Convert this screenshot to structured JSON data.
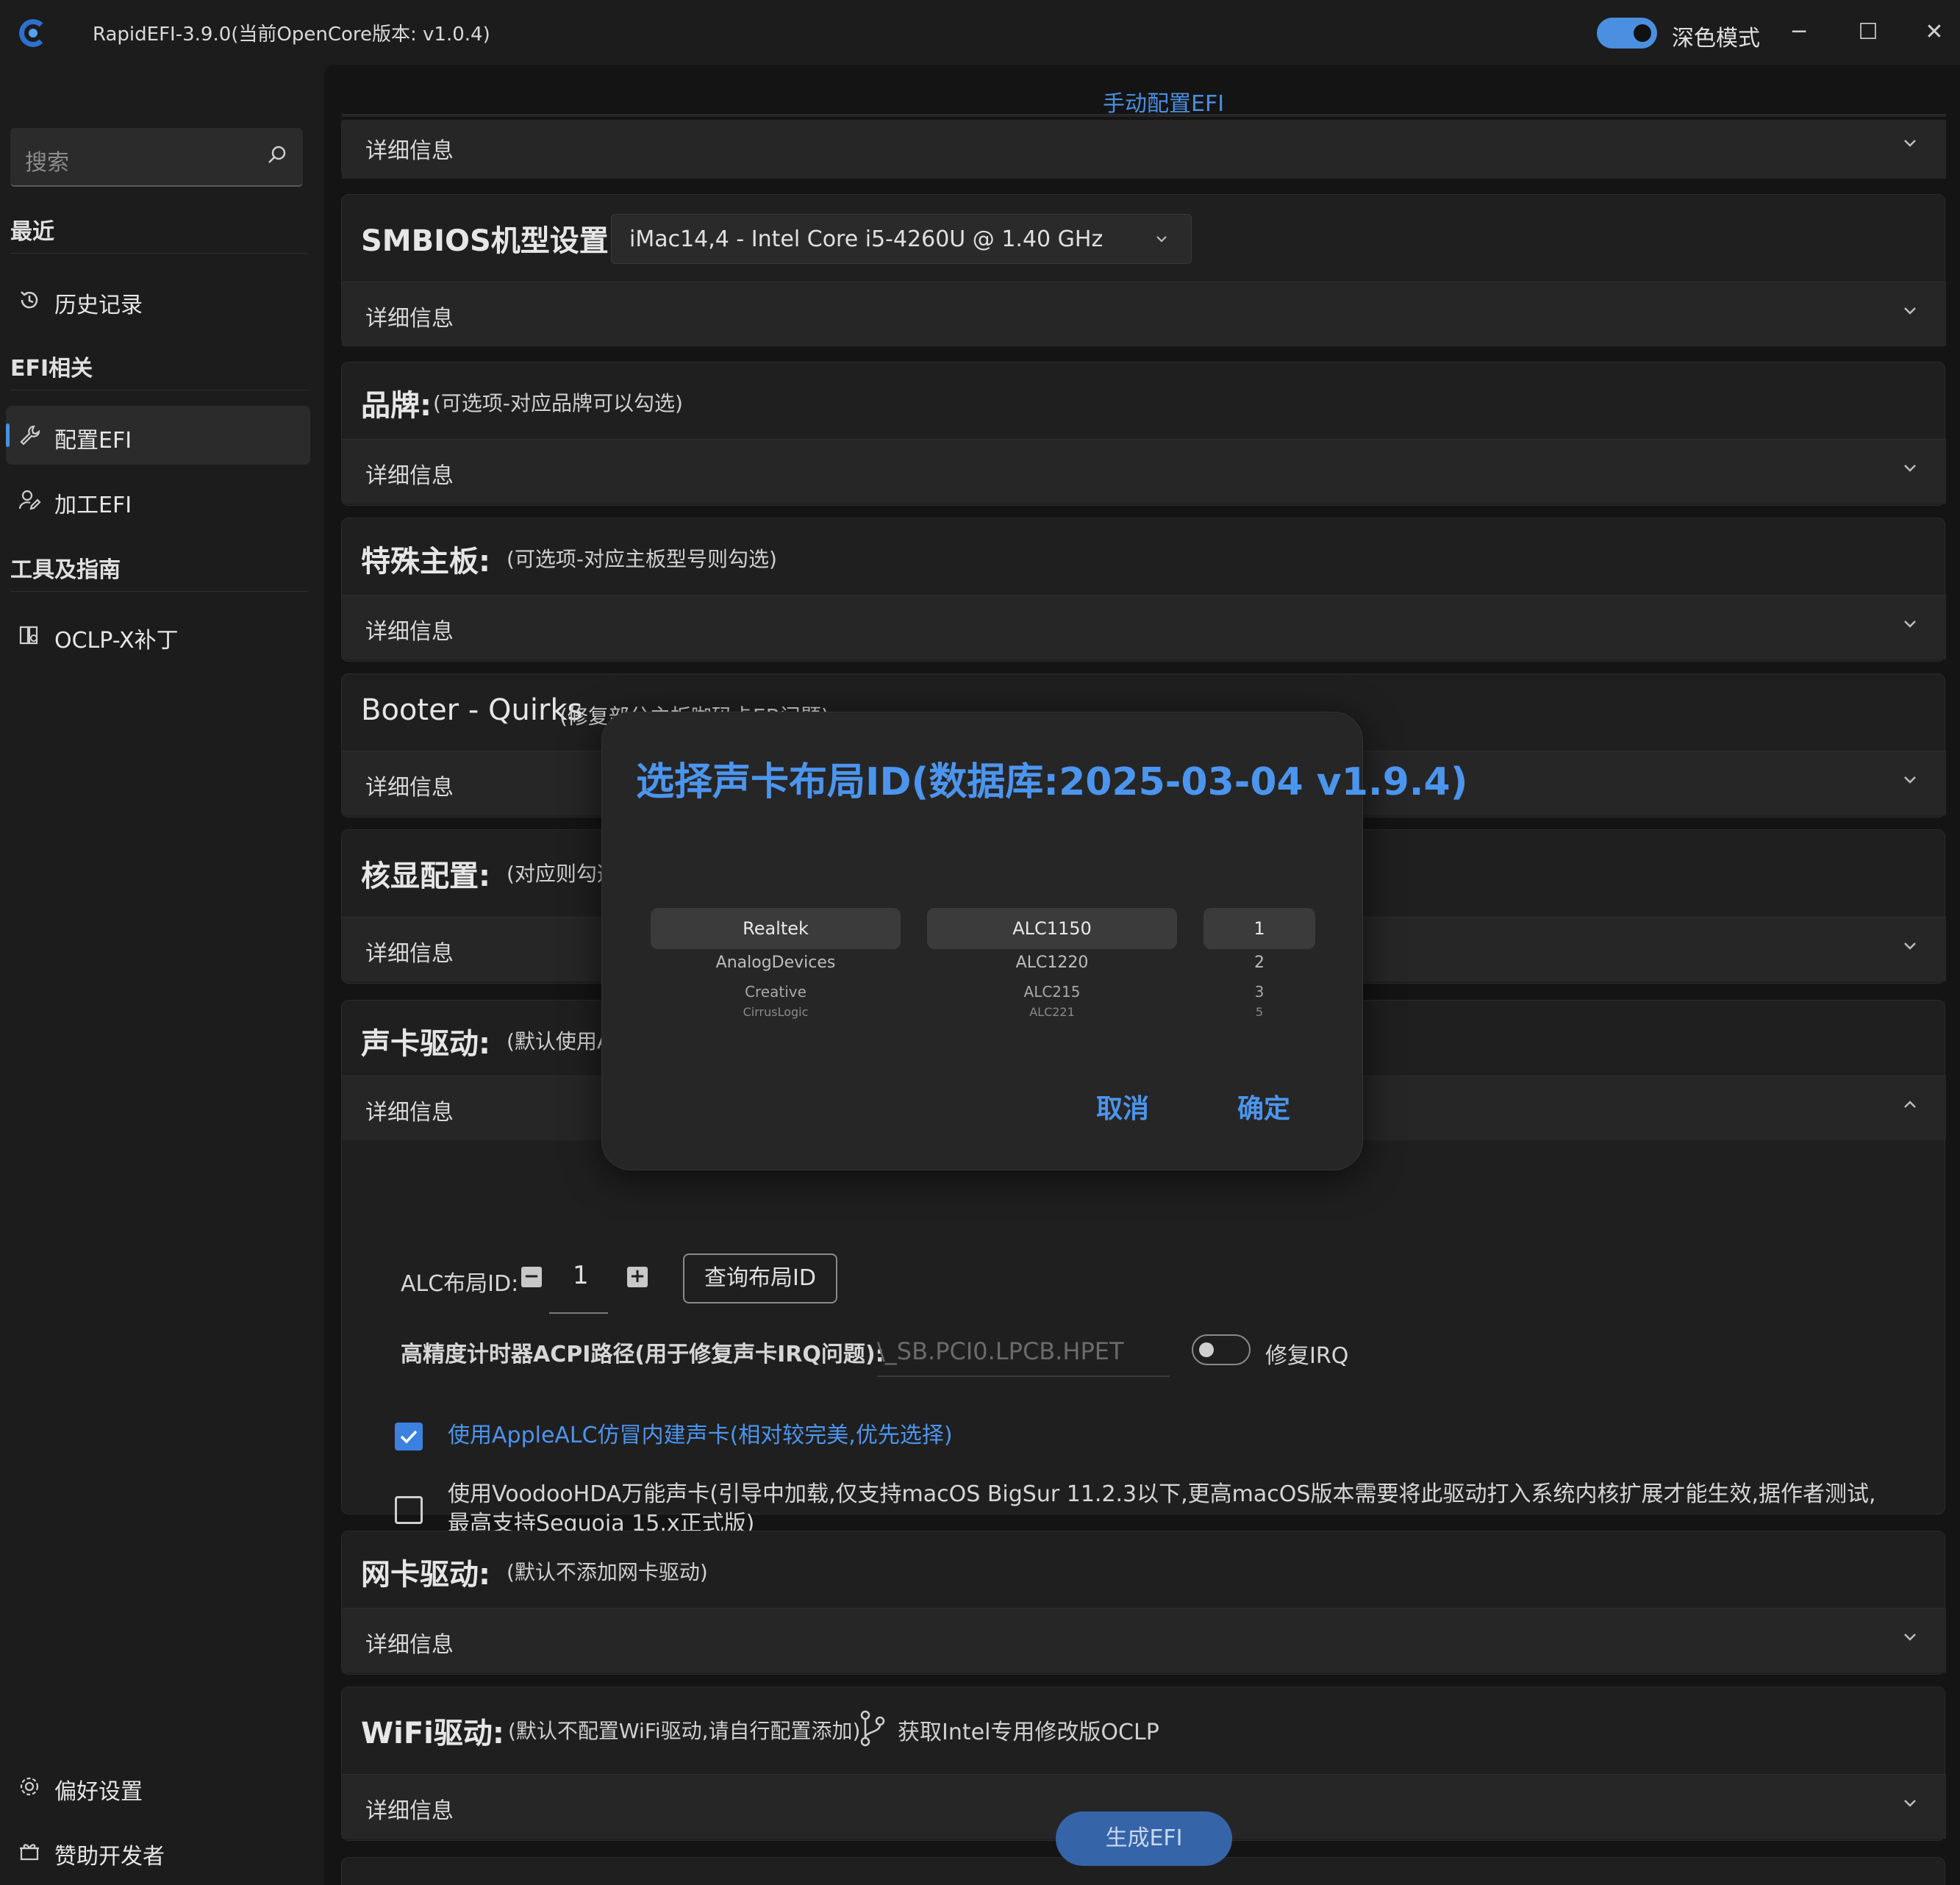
{
  "window": {
    "title": "RapidEFI-3.9.0(当前OpenCore版本: v1.0.4)",
    "dark_mode_label": "深色模式",
    "dark_mode_on": true,
    "minimize": "─",
    "maximize": "☐",
    "close": "✕"
  },
  "sidebar": {
    "search_placeholder": "搜索",
    "sections": {
      "recent": "最近",
      "efi": "EFI相关",
      "tools": "工具及指南"
    },
    "items": {
      "history": "历史记录",
      "config_efi": "配置EFI",
      "process_efi": "加工EFI",
      "oclp": "OCLP-X补丁",
      "preferences": "偏好设置",
      "sponsor": "赞助开发者"
    }
  },
  "main": {
    "tab": "手动配置EFI",
    "details_label": "详细信息",
    "smbios": {
      "title": "SMBIOS机型设置:",
      "value": "iMac14,4 - Intel Core i5-4260U @ 1.40 GHz"
    },
    "brand": {
      "title": "品牌:",
      "sub": "(可选项-对应品牌可以勾选)"
    },
    "board": {
      "title": "特殊主板:",
      "sub": "(可选项-对应主板型号则勾选)"
    },
    "booter": {
      "title": "Booter - Quirks",
      "sub": "(修复部分主板咖码卡EB问题)"
    },
    "igpu": {
      "title": "核显配置:",
      "sub": "(对应则勾选,否"
    },
    "audio": {
      "title": "声卡驱动:",
      "sub": "(默认使用Ap",
      "alc_label": "ALC布局ID:",
      "alc_value": "1",
      "query_button": "查询布局ID",
      "hpet_label": "高精度计时器ACPI路径(用于修复声卡IRQ问题):",
      "hpet_placeholder": "\\_SB.PCI0.LPCB.HPET",
      "irq_label": "修复IRQ",
      "irq_on": false,
      "option_applealc": "使用AppleALC仿冒内建声卡(相对较完美,优先选择)",
      "option_applealc_checked": true,
      "option_voodoo": "使用VoodooHDA万能声卡(引导中加载,仅支持macOS BigSur 11.2.3以下,更高macOS版本需要将此驱动打入系统内核扩展才能生效,据作者测试,最高支持Sequoia 15.x正式版)",
      "option_voodoo_checked": false
    },
    "nic": {
      "title": "网卡驱动:",
      "sub": "(默认不添加网卡驱动)"
    },
    "wifi": {
      "title": "WiFi驱动:",
      "sub": "(默认不配置WiFi驱动,请自行配置添加)",
      "link": "获取Intel专用修改版OCLP"
    },
    "generate_button": "生成EFI"
  },
  "modal": {
    "title": "选择声卡布局ID(数据库:2025-03-04 v1.9.4)",
    "vendors": [
      "Realtek",
      "AnalogDevices",
      "Creative",
      "CirrusLogic"
    ],
    "codecs": [
      "ALC1150",
      "ALC1220",
      "ALC215",
      "ALC221"
    ],
    "ids": [
      "1",
      "2",
      "3",
      "5"
    ],
    "cancel": "取消",
    "confirm": "确定"
  },
  "colors": {
    "accent": "#4c95ee",
    "background": "#141414",
    "card": "#1f1f1f"
  }
}
